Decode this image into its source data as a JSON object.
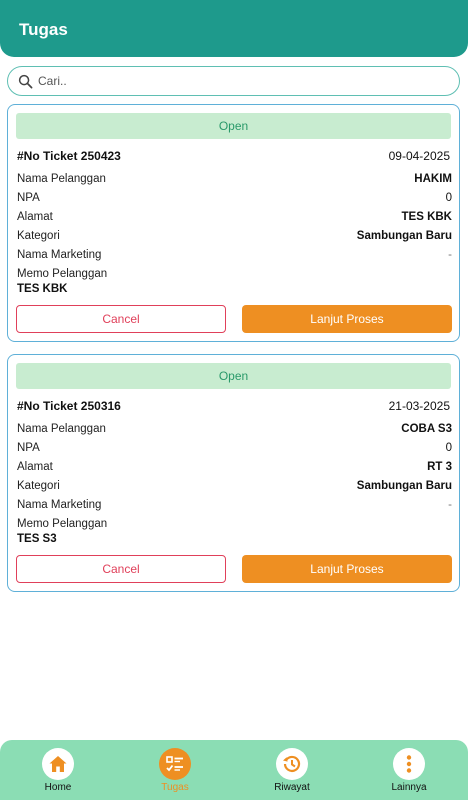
{
  "header": {
    "title": "Tugas"
  },
  "search": {
    "placeholder": "Cari.."
  },
  "labels": {
    "nama_pelanggan": "Nama Pelanggan",
    "npa": "NPA",
    "alamat": "Alamat",
    "kategori": "Kategori",
    "nama_marketing": "Nama Marketing",
    "memo_pelanggan": "Memo Pelanggan",
    "cancel": "Cancel",
    "lanjut_proses": "Lanjut Proses"
  },
  "tickets": [
    {
      "status": "Open",
      "ticket_no": "#No Ticket 250423",
      "date": "09-04-2025",
      "nama_pelanggan": "HAKIM",
      "npa": "0",
      "alamat": "TES KBK",
      "kategori": "Sambungan Baru",
      "nama_marketing": "-",
      "memo": "TES KBK"
    },
    {
      "status": "Open",
      "ticket_no": "#No Ticket 250316",
      "date": "21-03-2025",
      "nama_pelanggan": "COBA S3",
      "npa": "0",
      "alamat": "RT 3",
      "kategori": "Sambungan Baru",
      "nama_marketing": "-",
      "memo": "TES S3"
    }
  ],
  "nav": {
    "items": [
      {
        "label": "Home",
        "icon": "home-icon"
      },
      {
        "label": "Tugas",
        "icon": "task-list-icon"
      },
      {
        "label": "Riwayat",
        "icon": "history-icon"
      },
      {
        "label": "Lainnya",
        "icon": "more-vertical-icon"
      }
    ],
    "active": "Tugas"
  },
  "colors": {
    "header": "#1e9a8c",
    "accent": "#ee8f22",
    "nav_bg": "#8bddb4",
    "status_bg": "#c8ecd0",
    "cancel": "#e0405a"
  }
}
